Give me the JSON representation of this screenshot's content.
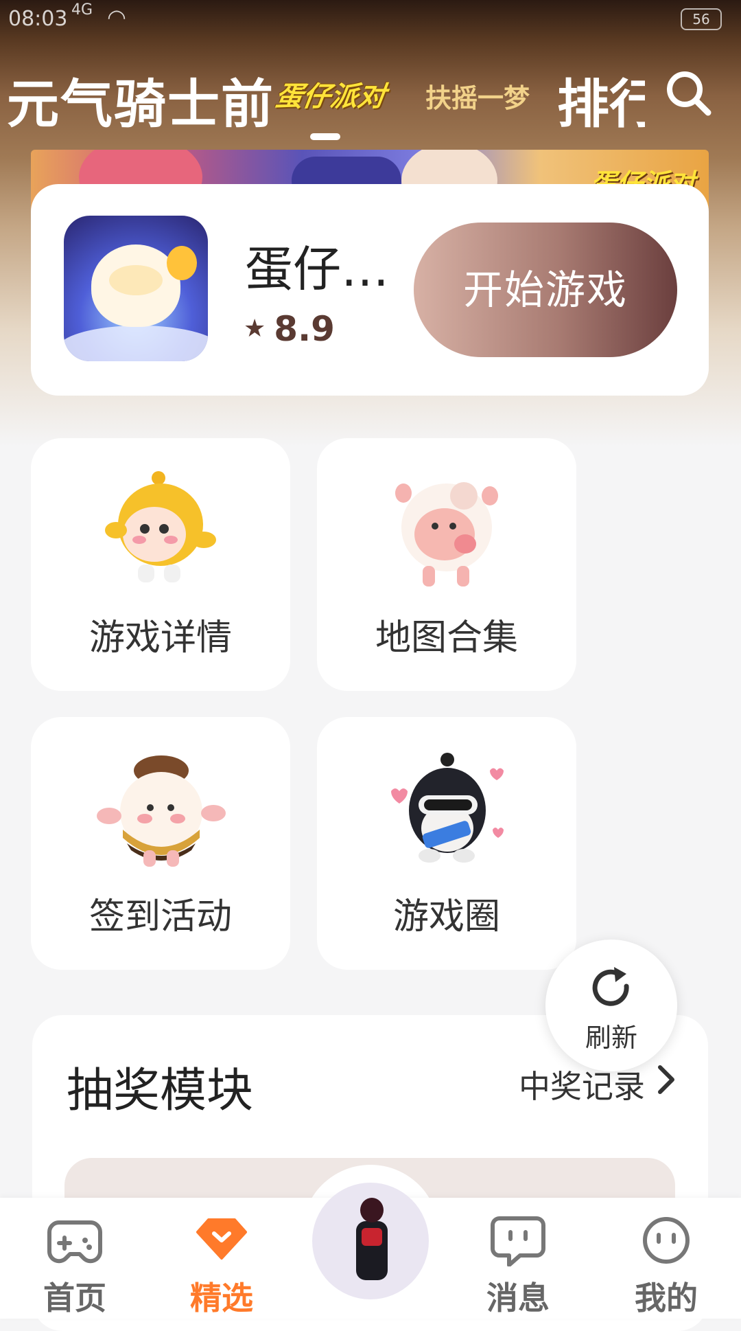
{
  "status_bar": {
    "time": "08:03",
    "network": "4G",
    "battery": "56"
  },
  "top_tabs": {
    "items": [
      "元气骑士前",
      "蛋仔派对",
      "扶摇一梦",
      "排行"
    ],
    "active_index": 1
  },
  "game_card": {
    "title": "蛋仔…",
    "rating": "8.9",
    "play_label": "开始游戏",
    "banner_tag": "蛋仔派对"
  },
  "tiles": [
    {
      "label": "游戏详情",
      "icon": "yellow-egg-mascot-icon"
    },
    {
      "label": "地图合集",
      "icon": "pink-sheep-mascot-icon"
    },
    {
      "label": "签到活动",
      "icon": "bee-mascot-icon"
    },
    {
      "label": "游戏圈",
      "icon": "masked-penguin-mascot-icon"
    }
  ],
  "refresh": {
    "label": "刷新",
    "icon": "refresh-icon"
  },
  "lottery": {
    "title": "抽奖模块",
    "record_label": "中奖记录"
  },
  "bottom_nav": {
    "items": [
      {
        "label": "首页",
        "icon": "gamepad-icon"
      },
      {
        "label": "精选",
        "icon": "heart-diamond-icon"
      },
      {
        "label": "消息",
        "icon": "chat-bubble-icon"
      },
      {
        "label": "我的",
        "icon": "smiley-face-icon"
      }
    ],
    "active_index": 1,
    "center_icon": "character-avatar-icon"
  },
  "colors": {
    "accent": "#ff7a2a",
    "play_button_start": "#d7b1a5",
    "play_button_end": "#6b3f3e",
    "page_bg": "#f5f5f6"
  }
}
